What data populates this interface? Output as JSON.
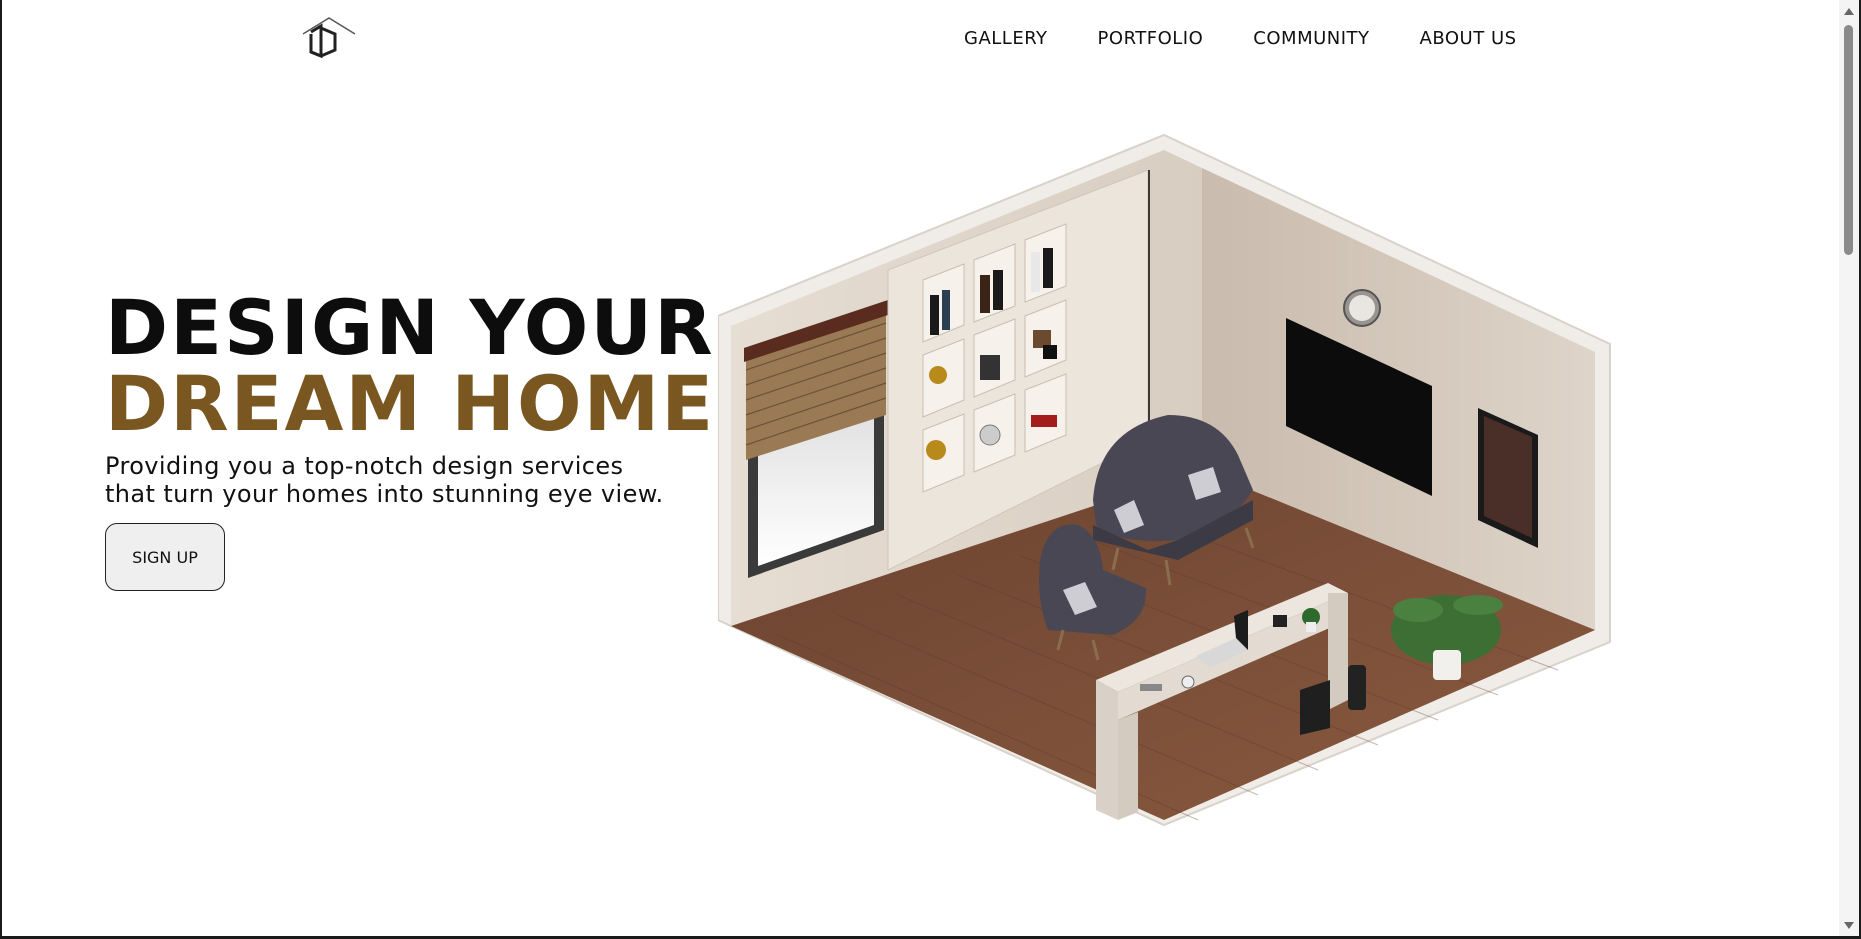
{
  "logo": {
    "icon": "house-logo-icon"
  },
  "nav": {
    "items": [
      {
        "label": "GALLERY"
      },
      {
        "label": "PORTFOLIO"
      },
      {
        "label": "COMMUNITY"
      },
      {
        "label": "ABOUT US"
      }
    ]
  },
  "hero": {
    "title_line1": "DESIGN YOUR",
    "title_line2": "DREAM HOME",
    "subtitle_line1": "Providing you a top-notch design services",
    "subtitle_line2": "that turn your homes into stunning eye view.",
    "signup_label": "SIGN UP",
    "accent_color": "#7a5720"
  },
  "room_image": {
    "icon": "isometric-room-illustration"
  }
}
